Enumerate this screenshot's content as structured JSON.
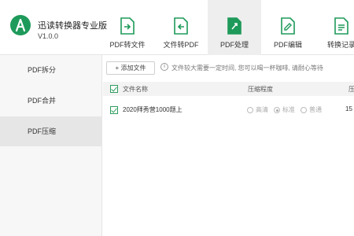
{
  "app": {
    "name": "迅读转换器专业版",
    "version": "V1.0.0",
    "accent": "#1e9a5a"
  },
  "tools": [
    {
      "label": "PDF转文件",
      "icon": "pdf-to-file-icon",
      "active": false
    },
    {
      "label": "文件转PDF",
      "icon": "file-to-pdf-icon",
      "active": false
    },
    {
      "label": "PDF处理",
      "icon": "pdf-process-icon",
      "active": true
    },
    {
      "label": "PDF编辑",
      "icon": "pdf-edit-icon",
      "active": false
    },
    {
      "label": "转换记录",
      "icon": "history-icon",
      "active": false
    }
  ],
  "sidebar": {
    "items": [
      {
        "label": "PDF拆分",
        "active": false
      },
      {
        "label": "PDF合并",
        "active": false
      },
      {
        "label": "PDF压缩",
        "active": true
      }
    ]
  },
  "toolbar": {
    "add_label": "+ 添加文件",
    "notice": "文件较大需要一定时间, 您可以喝一杯咖啡, 请耐心等待"
  },
  "table": {
    "headers": {
      "name": "文件名称",
      "level": "压缩程度",
      "extra": "压"
    },
    "rows": [
      {
        "name": "2020拜秀营1000题上",
        "options": [
          "高清",
          "标准",
          "普通"
        ],
        "selected": "标准",
        "extra": "15"
      }
    ]
  }
}
